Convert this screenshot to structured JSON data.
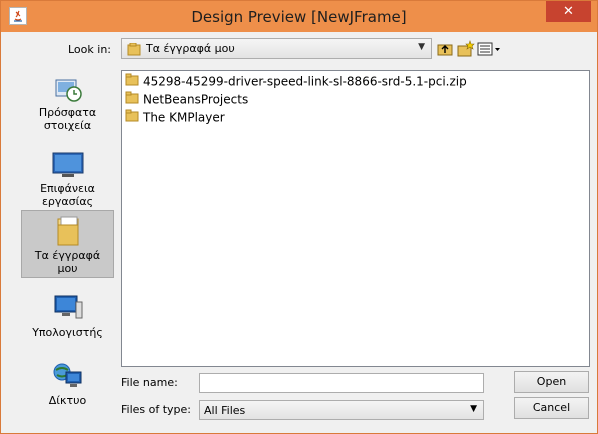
{
  "window": {
    "title": "Design Preview [NewJFrame]",
    "close_glyph": "✕"
  },
  "lookin": {
    "label": "Look in:",
    "value": "Τα έγγραφά μου",
    "arrow": "▼"
  },
  "toolbar": {
    "icons": [
      "up-folder-icon",
      "new-folder-icon",
      "view-menu-icon"
    ]
  },
  "places": [
    {
      "label_line1": "Πρόσφατα",
      "label_line2": "στοιχεία",
      "icon": "recent-items-icon"
    },
    {
      "label_line1": "Επιφάνεια",
      "label_line2": "εργασίας",
      "icon": "desktop-icon"
    },
    {
      "label_line1": "Τα έγγραφά",
      "label_line2": "μου",
      "icon": "documents-icon",
      "selected": true
    },
    {
      "label_line1": "Υπολογιστής",
      "label_line2": "",
      "icon": "computer-icon"
    },
    {
      "label_line1": "Δίκτυο",
      "label_line2": "",
      "icon": "network-icon"
    }
  ],
  "files": [
    {
      "name": "45298-45299-driver-speed-link-sl-8866-srd-5.1-pci.zip"
    },
    {
      "name": "NetBeansProjects"
    },
    {
      "name": "The KMPlayer"
    }
  ],
  "filename": {
    "label": "File name:",
    "value": ""
  },
  "filetype": {
    "label": "Files of type:",
    "value": "All Files",
    "arrow": "▼"
  },
  "buttons": {
    "open": "Open",
    "cancel": "Cancel"
  },
  "colors": {
    "titlebar": "#ee8f4a",
    "close": "#c7432f",
    "folder": "#e8c15a"
  }
}
